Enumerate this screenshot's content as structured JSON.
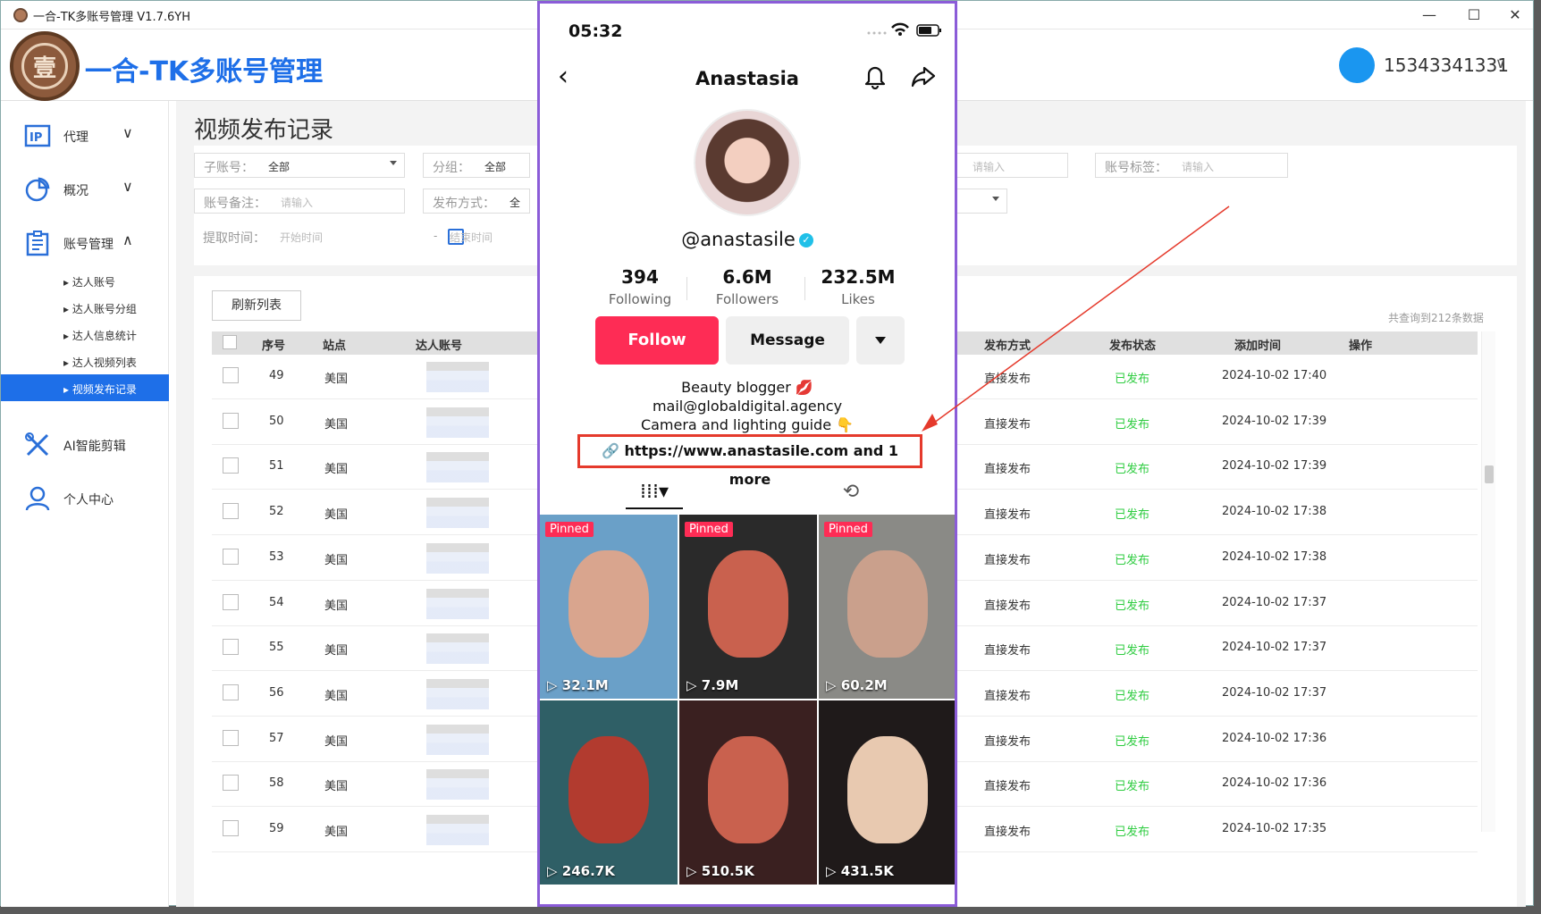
{
  "window": {
    "title": "一合-TK多账号管理 V1.7.6YH"
  },
  "header": {
    "brand": "一合-TK多账号管理",
    "logo_glyph": "壹",
    "user": "15343341331"
  },
  "sidebar": {
    "items": [
      {
        "label": "代理",
        "icon": "ip-icon"
      },
      {
        "label": "概况",
        "icon": "pie-chart-icon"
      },
      {
        "label": "账号管理",
        "icon": "clipboard-icon"
      },
      {
        "label": "AI智能剪辑",
        "icon": "tools-icon"
      },
      {
        "label": "个人中心",
        "icon": "user-icon"
      }
    ],
    "subitems": [
      "达人账号",
      "达人账号分组",
      "达人信息统计",
      "达人视频列表",
      "视频发布记录"
    ]
  },
  "page": {
    "title": "视频发布记录"
  },
  "filters": {
    "sub_account_label": "子账号：",
    "sub_account_value": "全部",
    "group_label": "分组：",
    "group_value": "全部",
    "account_tag_label": "账号标签：",
    "account_tag_placeholder": "请输入",
    "right_input_placeholder": "请输入",
    "account_note_label": "账号备注：",
    "account_note_placeholder": "请输入",
    "publish_method_label": "发布方式：",
    "publish_method_value": "全",
    "extract_time_label": "提取时间：",
    "start_placeholder": "开始时间",
    "end_placeholder": "结束时间",
    "range_sep": "-"
  },
  "table": {
    "refresh_label": "刷新列表",
    "total_text": "共查询到212条数据",
    "headers": {
      "index": "序号",
      "site": "站点",
      "account": "达人账号",
      "method": "发布方式",
      "status": "发布状态",
      "added": "添加时间",
      "ops": "操作"
    },
    "rows": [
      {
        "index": "49",
        "site": "美国",
        "method": "直接发布",
        "status": "已发布",
        "added": "2024-10-02 17:40"
      },
      {
        "index": "50",
        "site": "美国",
        "method": "直接发布",
        "status": "已发布",
        "added": "2024-10-02 17:39"
      },
      {
        "index": "51",
        "site": "美国",
        "method": "直接发布",
        "status": "已发布",
        "added": "2024-10-02 17:39"
      },
      {
        "index": "52",
        "site": "美国",
        "method": "直接发布",
        "status": "已发布",
        "added": "2024-10-02 17:38"
      },
      {
        "index": "53",
        "site": "美国",
        "method": "直接发布",
        "status": "已发布",
        "added": "2024-10-02 17:38"
      },
      {
        "index": "54",
        "site": "美国",
        "method": "直接发布",
        "status": "已发布",
        "added": "2024-10-02 17:37"
      },
      {
        "index": "55",
        "site": "美国",
        "method": "直接发布",
        "status": "已发布",
        "added": "2024-10-02 17:37"
      },
      {
        "index": "56",
        "site": "美国",
        "method": "直接发布",
        "status": "已发布",
        "added": "2024-10-02 17:37"
      },
      {
        "index": "57",
        "site": "美国",
        "method": "直接发布",
        "status": "已发布",
        "added": "2024-10-02 17:36"
      },
      {
        "index": "58",
        "site": "美国",
        "method": "直接发布",
        "status": "已发布",
        "added": "2024-10-02 17:36"
      },
      {
        "index": "59",
        "site": "美国",
        "method": "直接发布",
        "status": "已发布",
        "added": "2024-10-02 17:35"
      }
    ]
  },
  "phone": {
    "time": "05:32",
    "name": "Anastasia",
    "handle": "@anastasile",
    "stats": [
      {
        "value": "394",
        "label": "Following"
      },
      {
        "value": "6.6M",
        "label": "Followers"
      },
      {
        "value": "232.5M",
        "label": "Likes"
      }
    ],
    "follow_label": "Follow",
    "message_label": "Message",
    "bio": [
      "Beauty blogger 💋",
      "mail@globaldigital.agency",
      "Camera and lighting guide 👇"
    ],
    "link": "https://www.anastasile.com  and 1 more",
    "pinned_label": "Pinned",
    "videos": [
      {
        "views": "32.1M",
        "pinned": true,
        "bg": "#6aa0c8",
        "face": "#d9a58e"
      },
      {
        "views": "7.9M",
        "pinned": true,
        "bg": "#2a2a2a",
        "face": "#c9614e"
      },
      {
        "views": "60.2M",
        "pinned": true,
        "bg": "#8a8a86",
        "face": "#caa08c"
      },
      {
        "views": "246.7K",
        "pinned": false,
        "bg": "#2f5f66",
        "face": "#b23b2f"
      },
      {
        "views": "510.5K",
        "pinned": false,
        "bg": "#3a2020",
        "face": "#c9614e"
      },
      {
        "views": "431.5K",
        "pinned": false,
        "bg": "#1f1a1a",
        "face": "#e8c9b0"
      }
    ]
  },
  "colors": {
    "accent": "#1e6fe8",
    "tiktok_red": "#fe2c55",
    "status_green": "#2ecc40",
    "annotation_red": "#e53a2c"
  }
}
